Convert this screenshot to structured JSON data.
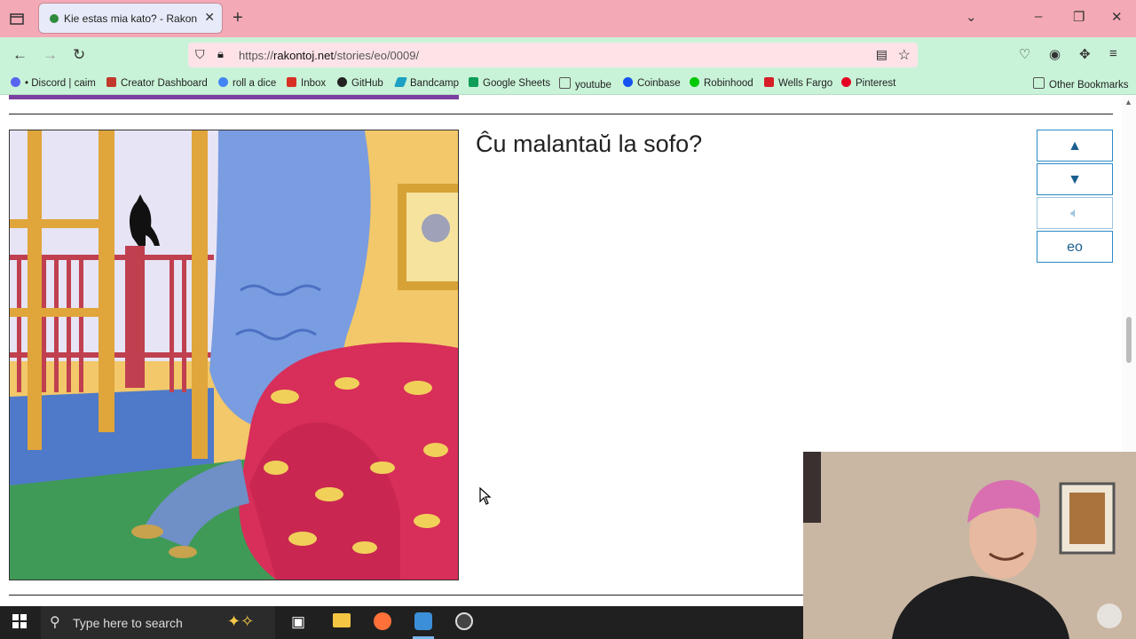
{
  "browser": {
    "tab_title": "Kie estas mia kato? - Rakontoj p",
    "url_prefix": "https://",
    "url_domain": "rakontoj.net",
    "url_path": "/stories/eo/0009/",
    "bookmarks": [
      {
        "label": "• Discord | caim",
        "color": "#5865f2"
      },
      {
        "label": "Creator Dashboard",
        "color": "#c0392b"
      },
      {
        "label": "roll a dice",
        "color": "#4285f4"
      },
      {
        "label": "Inbox",
        "color": "#d93025"
      },
      {
        "label": "GitHub",
        "color": "#222222"
      },
      {
        "label": "Bandcamp",
        "color": "#1da0c3"
      },
      {
        "label": "Google Sheets",
        "color": "#0f9d58"
      },
      {
        "label": "youtube",
        "color": "#777777"
      },
      {
        "label": "Coinbase",
        "color": "#1652f0"
      },
      {
        "label": "Robinhood",
        "color": "#00c805"
      },
      {
        "label": "Wells Fargo",
        "color": "#d71e28"
      },
      {
        "label": "Pinterest",
        "color": "#e60023"
      }
    ],
    "other_bookmarks": "Other Bookmarks"
  },
  "story": {
    "sentence": "Ĉu malantaŭ la sofo?",
    "buttons": {
      "up_icon": "arrow-up-icon",
      "down_icon": "arrow-down-icon",
      "audio_icon": "speaker-icon",
      "lang": "eo"
    }
  },
  "taskbar": {
    "search_placeholder": "Type here to search"
  }
}
